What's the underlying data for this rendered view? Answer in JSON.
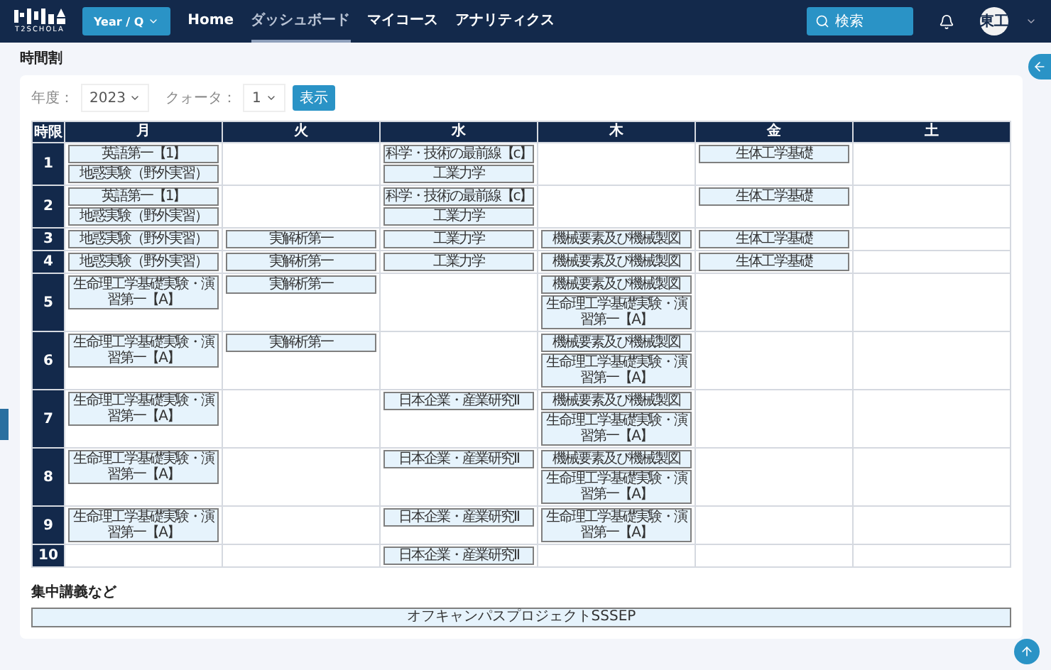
{
  "nav": {
    "logo_text": "T2SCHOLA",
    "term_button": "Year / Q",
    "links": [
      {
        "label": "Home",
        "selected": false
      },
      {
        "label": "ダッシュボード",
        "selected": true
      },
      {
        "label": "マイコース",
        "selected": false
      },
      {
        "label": "アナリティクス",
        "selected": false
      }
    ],
    "search": "検索",
    "avatar": "東工"
  },
  "page_title": "時間割",
  "filters": {
    "year_label": "年度：",
    "year": "2023",
    "quarter_label": "クォータ：",
    "quarter": "1",
    "show_button": "表示"
  },
  "timetable": {
    "corner": "時限",
    "days": [
      "月",
      "火",
      "水",
      "木",
      "金",
      "土"
    ],
    "periods": [
      {
        "label": "1",
        "cells": [
          [
            "英語第一【1】",
            "地惑実験（野外実習）"
          ],
          [],
          [
            "科学・技術の最前線【c】",
            "工業力学"
          ],
          [],
          [
            "生体工学基礎"
          ],
          []
        ]
      },
      {
        "label": "2",
        "cells": [
          [
            "英語第一【1】",
            "地惑実験（野外実習）"
          ],
          [],
          [
            "科学・技術の最前線【c】",
            "工業力学"
          ],
          [],
          [
            "生体工学基礎"
          ],
          []
        ]
      },
      {
        "label": "3",
        "cells": [
          [
            "地惑実験（野外実習）"
          ],
          [
            "実解析第一"
          ],
          [
            "工業力学"
          ],
          [
            "機械要素及び機械製図"
          ],
          [
            "生体工学基礎"
          ],
          []
        ]
      },
      {
        "label": "4",
        "cells": [
          [
            "地惑実験（野外実習）"
          ],
          [
            "実解析第一"
          ],
          [
            "工業力学"
          ],
          [
            "機械要素及び機械製図"
          ],
          [
            "生体工学基礎"
          ],
          []
        ]
      },
      {
        "label": "5",
        "cells": [
          [
            "生命理工学基礎実験・演習第一【A】"
          ],
          [
            "実解析第一"
          ],
          [],
          [
            "機械要素及び機械製図",
            "生命理工学基礎実験・演習第一【A】"
          ],
          [],
          []
        ]
      },
      {
        "label": "6",
        "cells": [
          [
            "生命理工学基礎実験・演習第一【A】"
          ],
          [
            "実解析第一"
          ],
          [],
          [
            "機械要素及び機械製図",
            "生命理工学基礎実験・演習第一【A】"
          ],
          [],
          []
        ]
      },
      {
        "label": "7",
        "cells": [
          [
            "生命理工学基礎実験・演習第一【A】"
          ],
          [],
          [
            "日本企業・産業研究Ⅱ"
          ],
          [
            "機械要素及び機械製図",
            "生命理工学基礎実験・演習第一【A】"
          ],
          [],
          []
        ]
      },
      {
        "label": "8",
        "cells": [
          [
            "生命理工学基礎実験・演習第一【A】"
          ],
          [],
          [
            "日本企業・産業研究Ⅱ"
          ],
          [
            "機械要素及び機械製図",
            "生命理工学基礎実験・演習第一【A】"
          ],
          [],
          []
        ]
      },
      {
        "label": "9",
        "cells": [
          [
            "生命理工学基礎実験・演習第一【A】"
          ],
          [],
          [
            "日本企業・産業研究Ⅱ"
          ],
          [
            "生命理工学基礎実験・演習第一【A】"
          ],
          [],
          []
        ]
      },
      {
        "label": "10",
        "cells": [
          [],
          [],
          [
            "日本企業・産業研究Ⅱ"
          ],
          [],
          [],
          []
        ]
      }
    ]
  },
  "intensive": {
    "title": "集中講義など",
    "courses": [
      "オフキャンパスプロジェクトSSSEP"
    ]
  }
}
